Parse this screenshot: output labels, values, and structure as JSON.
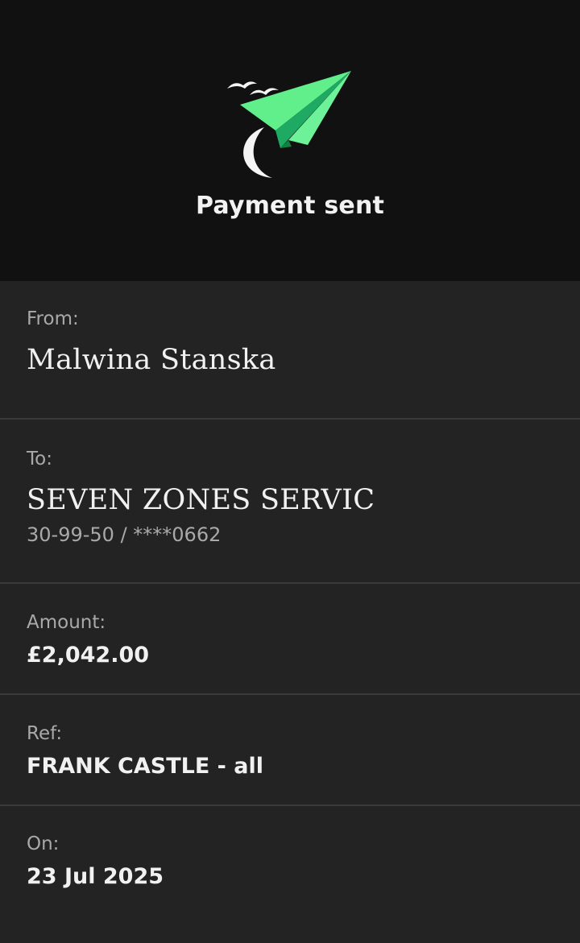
{
  "header": {
    "title": "Payment sent",
    "icon": "paper-plane-icon",
    "accent": "#3ddc84"
  },
  "details": {
    "from": {
      "label": "From:",
      "value": "Malwina Stanska"
    },
    "to": {
      "label": "To:",
      "value": "SEVEN ZONES SERVIC",
      "account": "30-99-50 / ****0662"
    },
    "amount": {
      "label": "Amount:",
      "value": "£2,042.00"
    },
    "ref": {
      "label": "Ref:",
      "value": "FRANK CASTLE - all"
    },
    "on": {
      "label": "On:",
      "value": "23 Jul 2025"
    }
  }
}
